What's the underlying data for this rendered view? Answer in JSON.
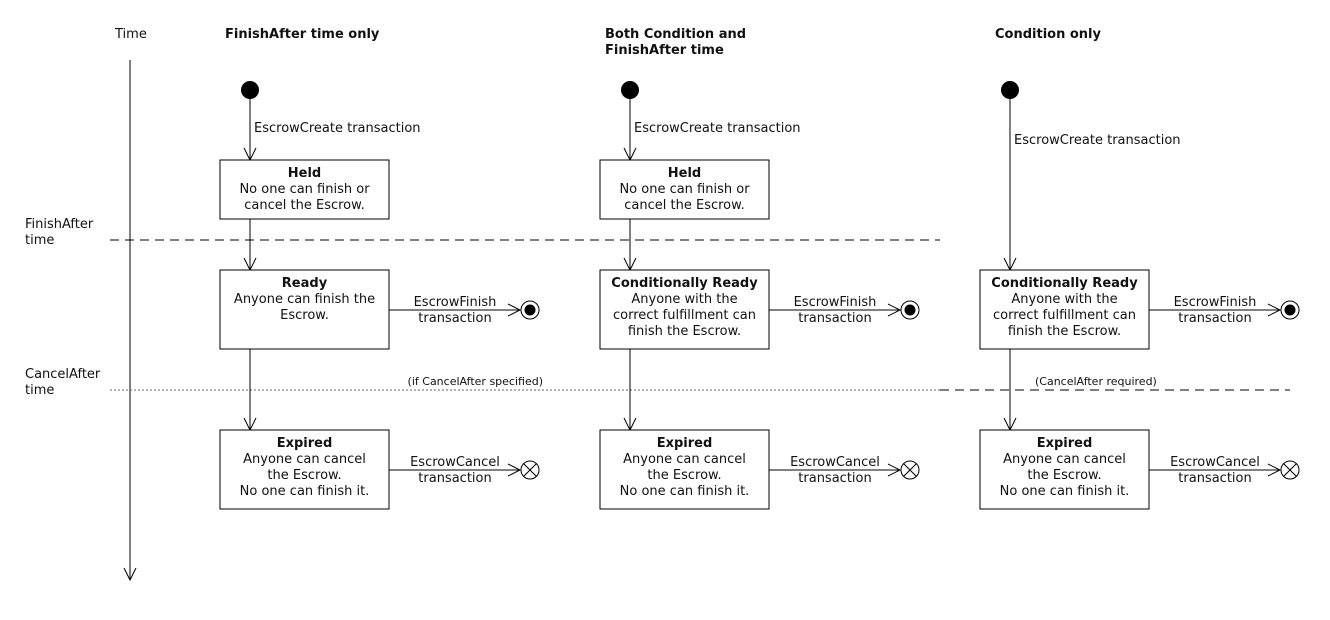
{
  "time_axis": {
    "label": "Time",
    "markers": [
      {
        "line1": "FinishAfter",
        "line2": "time"
      },
      {
        "line1": "CancelAfter",
        "line2": "time"
      }
    ]
  },
  "columns": [
    {
      "title_lines": [
        "FinishAfter time only"
      ],
      "create_label": "EscrowCreate transaction",
      "held": {
        "title": "Held",
        "lines": [
          "No one can finish or",
          "cancel the Escrow."
        ]
      },
      "ready": {
        "title": "Ready",
        "lines": [
          "Anyone can finish the",
          "Escrow."
        ]
      },
      "finish_label": [
        "EscrowFinish",
        "transaction"
      ],
      "cancel_note": "(if CancelAfter specified)",
      "expired": {
        "title": "Expired",
        "lines": [
          "Anyone can cancel",
          "the Escrow.",
          "No one can finish it."
        ]
      },
      "cancel_label": [
        "EscrowCancel",
        "transaction"
      ]
    },
    {
      "title_lines": [
        "Both Condition and",
        "FinishAfter time"
      ],
      "create_label": "EscrowCreate transaction",
      "held": {
        "title": "Held",
        "lines": [
          "No one can finish or",
          "cancel the Escrow."
        ]
      },
      "ready": {
        "title": "Conditionally Ready",
        "lines": [
          "Anyone with the",
          "correct fulfillment can",
          "finish the Escrow."
        ]
      },
      "finish_label": [
        "EscrowFinish",
        "transaction"
      ],
      "expired": {
        "title": "Expired",
        "lines": [
          "Anyone can cancel",
          "the Escrow.",
          "No one can finish it."
        ]
      },
      "cancel_label": [
        "EscrowCancel",
        "transaction"
      ]
    },
    {
      "title_lines": [
        "Condition only"
      ],
      "create_label": "EscrowCreate transaction",
      "ready": {
        "title": "Conditionally Ready",
        "lines": [
          "Anyone with the",
          "correct fulfillment can",
          "finish the Escrow."
        ]
      },
      "finish_label": [
        "EscrowFinish",
        "transaction"
      ],
      "cancel_note": "(CancelAfter required)",
      "expired": {
        "title": "Expired",
        "lines": [
          "Anyone can cancel",
          "the Escrow.",
          "No one can finish it."
        ]
      },
      "cancel_label": [
        "EscrowCancel",
        "transaction"
      ]
    }
  ]
}
